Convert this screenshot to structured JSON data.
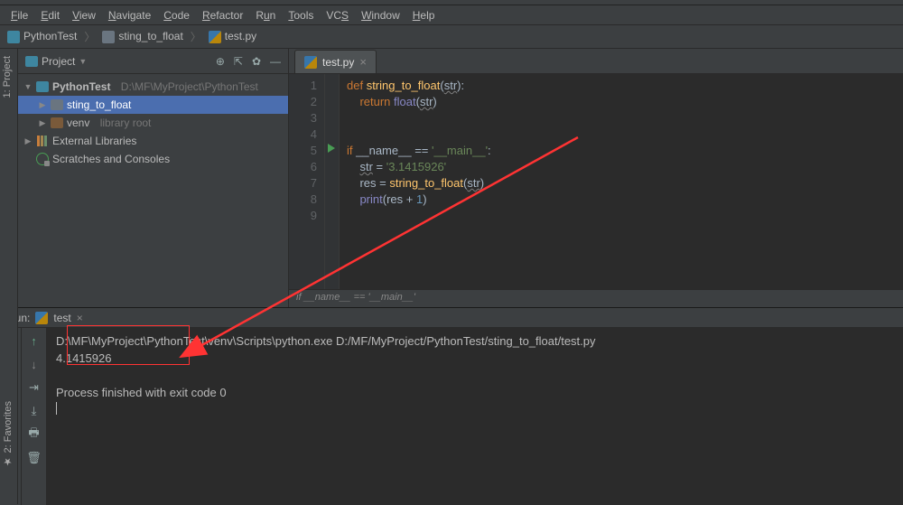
{
  "menu": {
    "file": "File",
    "edit": "Edit",
    "view": "View",
    "navigate": "Navigate",
    "code": "Code",
    "refactor": "Refactor",
    "run": "Run",
    "tools": "Tools",
    "vcs": "VCS",
    "window": "Window",
    "help": "Help"
  },
  "breadcrumb": {
    "root": "PythonTest",
    "folder": "sting_to_float",
    "file": "test.py"
  },
  "projectPanel": {
    "title": "Project",
    "arrow": "▼",
    "root": {
      "name": "PythonTest",
      "path": "D:\\MF\\MyProject\\PythonTest"
    },
    "folder": "sting_to_float",
    "venv": {
      "name": "venv",
      "badge": "library root"
    },
    "extLib": "External Libraries",
    "scratches": "Scratches and Consoles",
    "sideLabel": "1: Project"
  },
  "editor": {
    "tab": "test.py",
    "lines": [
      "1",
      "2",
      "3",
      "4",
      "5",
      "6",
      "7",
      "8",
      "9"
    ],
    "breadcrumb": "if __name__ == '__main__'"
  },
  "code": {
    "l1a": "def ",
    "l1b": "string_to_float",
    "l1c": "(",
    "l1d": "str",
    "l1e": "):",
    "l2a": "    return ",
    "l2b": "float",
    "l2c": "(",
    "l2d": "str",
    "l2e": ")",
    "l5a": "if ",
    "l5b": "__name__ ",
    "l5c": "== ",
    "l5d": "'__main__'",
    "l5e": ":",
    "l6a": "    ",
    "l6b": "str",
    "l6c": " = ",
    "l6d": "'3.1415926'",
    "l7a": "    res = ",
    "l7b": "string_to_float",
    "l7c": "(",
    "l7d": "str",
    "l7e": ")",
    "l8a": "    ",
    "l8b": "print",
    "l8c": "(res + ",
    "l8d": "1",
    "l8e": ")"
  },
  "run": {
    "label": "Run:",
    "tab": "test",
    "out1": "D:\\MF\\MyProject\\PythonTest\\venv\\Scripts\\python.exe D:/MF/MyProject/PythonTest/sting_to_float/test.py",
    "out2": "4.1415926",
    "out3": "",
    "out4": "Process finished with exit code 0"
  },
  "favLabel": "2: Favorites"
}
